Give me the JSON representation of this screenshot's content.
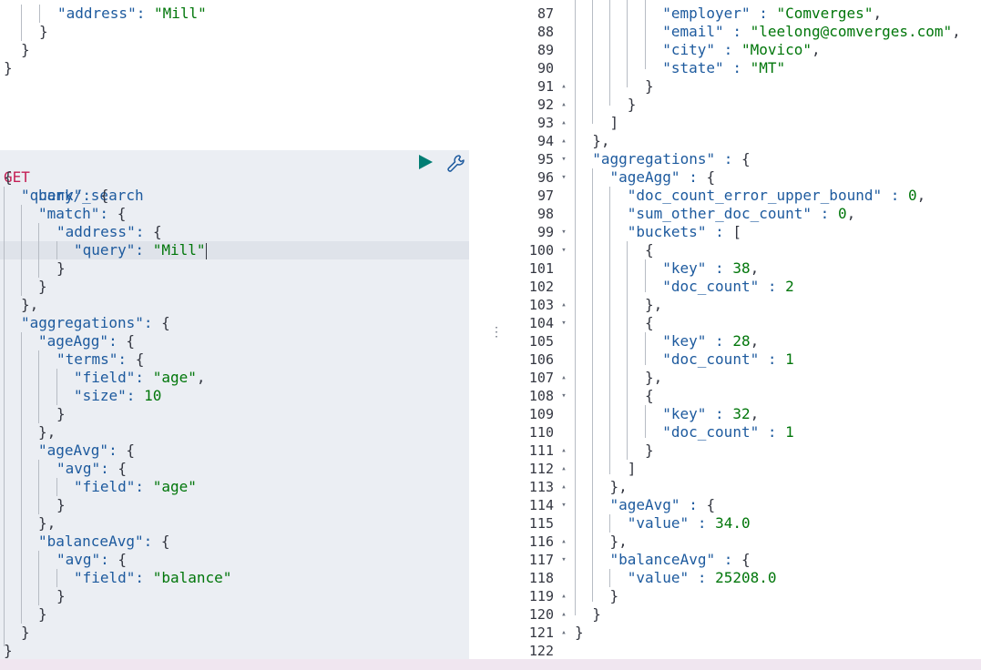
{
  "request": {
    "method": "GET",
    "path": "bank/_search",
    "prev_lines": [
      "\"address\": \"Mill\"",
      "}",
      "}",
      "}"
    ],
    "lines": [
      "{",
      "\"query\": {",
      "\"match\": {",
      "\"address\": {",
      "\"query\": \"Mill\"",
      "}",
      "}",
      "},",
      "\"aggregations\": {",
      "\"ageAgg\": {",
      "\"terms\": {",
      "\"field\": \"age\",",
      "\"size\": 10",
      "}",
      "},",
      "\"ageAvg\": {",
      "\"avg\": {",
      "\"field\": \"age\"",
      "}",
      "},",
      "\"balanceAvg\": {",
      "\"avg\": {",
      "\"field\": \"balance\"",
      "}",
      "}",
      "}",
      "}"
    ],
    "run_icon": "play-icon",
    "copy_icon": "wrench-icon"
  },
  "response": {
    "line_numbers": [
      "87",
      "88",
      "89",
      "90",
      "91",
      "92",
      "93",
      "94",
      "95",
      "96",
      "97",
      "98",
      "99",
      "100",
      "101",
      "102",
      "103",
      "104",
      "105",
      "106",
      "107",
      "108",
      "109",
      "110",
      "111",
      "112",
      "113",
      "114",
      "115",
      "116",
      "117",
      "118",
      "119",
      "120",
      "121",
      "122"
    ],
    "lines": [
      "\"employer\" : \"Comverges\",",
      "\"email\" : \"leelong@comverges.com\",",
      "\"city\" : \"Movico\",",
      "\"state\" : \"MT\"",
      "}",
      "}",
      "]",
      "},",
      "\"aggregations\" : {",
      "\"ageAgg\" : {",
      "\"doc_count_error_upper_bound\" : 0,",
      "\"sum_other_doc_count\" : 0,",
      "\"buckets\" : [",
      "{",
      "\"key\" : 38,",
      "\"doc_count\" : 2",
      "},",
      "{",
      "\"key\" : 28,",
      "\"doc_count\" : 1",
      "},",
      "{",
      "\"key\" : 32,",
      "\"doc_count\" : 1",
      "}",
      "]",
      "},",
      "\"ageAvg\" : {",
      "\"value\" : 34.0",
      "},",
      "\"balanceAvg\" : {",
      "\"value\" : 25208.0",
      "}",
      "}",
      "}",
      ""
    ]
  },
  "colors": {
    "key": "#1d5a9e",
    "string": "#00760a",
    "method": "#c41f55",
    "run_button": "#017d73"
  }
}
